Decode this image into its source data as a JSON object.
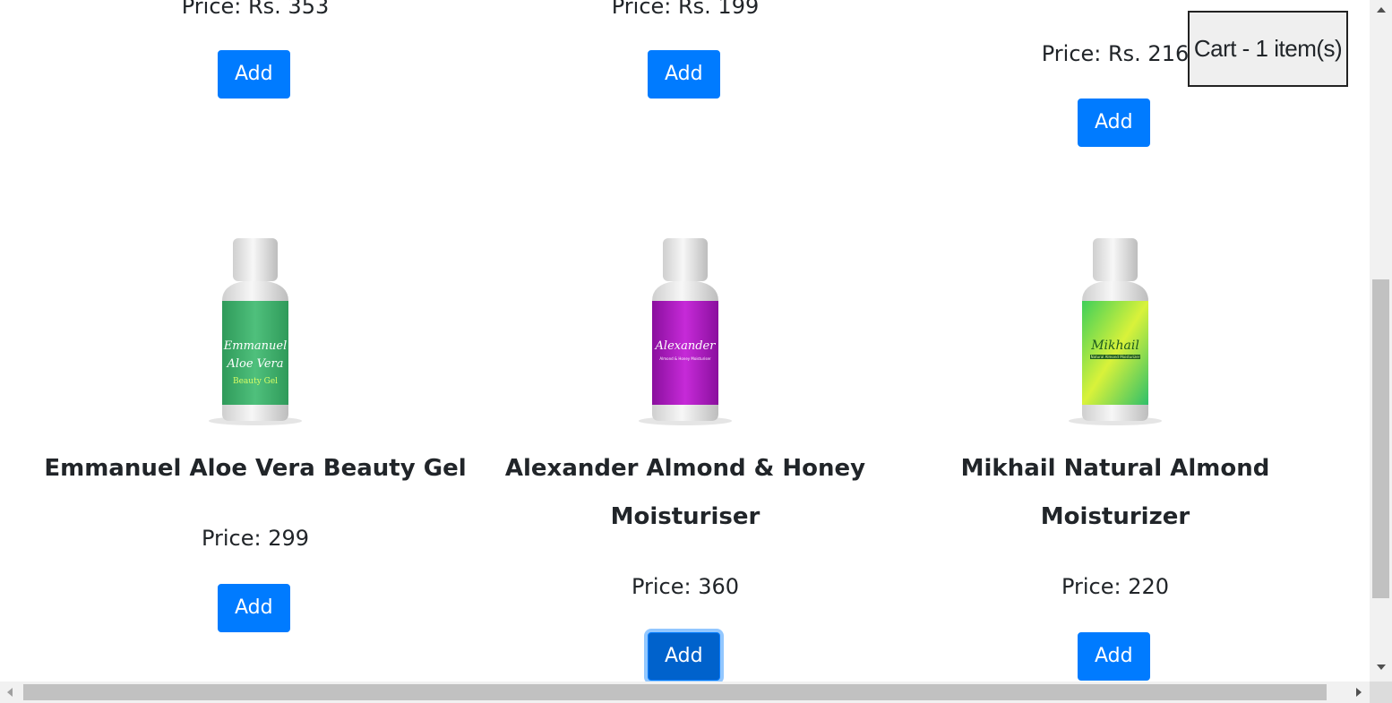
{
  "cart": {
    "label": "Cart - 1 item(s)"
  },
  "top_row": [
    {
      "price": "Price: Rs. 353",
      "button": "Add"
    },
    {
      "price": "Price: Rs. 199",
      "button": "Add"
    },
    {
      "price": "Price: Rs. 216",
      "button": "Add"
    }
  ],
  "products": [
    {
      "title": "Emmanuel Aloe Vera Beauty Gel",
      "price": "Price: 299",
      "button": "Add",
      "label_lines": [
        "Emmanuel",
        "Aloe Vera",
        "Beauty Gel"
      ],
      "label_color": "#3fae6a"
    },
    {
      "title_line1": "Alexander Almond & Honey",
      "title_line2": "Moisturiser",
      "price": "Price: 360",
      "button": "Add",
      "label_lines": [
        "Alexander",
        "Almond & Honey Moisturiser"
      ],
      "label_color": "#b21fc4"
    },
    {
      "title_line1": "Mikhail Natural Almond",
      "title_line2": "Moisturizer",
      "price": "Price: 220",
      "button": "Add",
      "label_lines": [
        "Mikhail",
        "Natural Almond Moisturizer"
      ],
      "label_color": "#9ee03a"
    }
  ],
  "colors": {
    "button_primary": "#007bff",
    "button_focused": "#0062cc"
  }
}
